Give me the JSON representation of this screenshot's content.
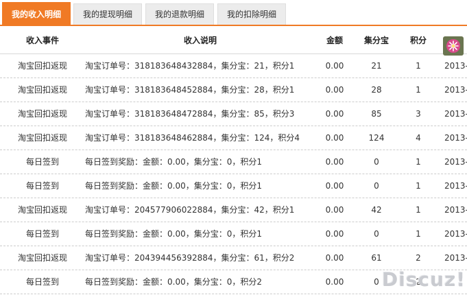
{
  "tabs": [
    {
      "label": "我的收入明细",
      "active": true
    },
    {
      "label": "我的提现明细",
      "active": false
    },
    {
      "label": "我的退款明细",
      "active": false
    },
    {
      "label": "我的扣除明细",
      "active": false
    }
  ],
  "colors": {
    "accent": "#f07a25",
    "tab_inactive": "#ececec"
  },
  "table": {
    "headers": [
      "收入事件",
      "收入说明",
      "金额",
      "集分宝",
      "积分"
    ],
    "rows": [
      {
        "event": "淘宝回扣返现",
        "desc": "淘宝订单号：318183648432884，集分宝：21，积分1",
        "amount": "0.00",
        "jfb": "21",
        "points": "1",
        "date": "2013-"
      },
      {
        "event": "淘宝回扣返现",
        "desc": "淘宝订单号：318183648452884，集分宝：28，积分1",
        "amount": "0.00",
        "jfb": "28",
        "points": "1",
        "date": "2013-"
      },
      {
        "event": "淘宝回扣返现",
        "desc": "淘宝订单号：318183648472884，集分宝：85，积分3",
        "amount": "0.00",
        "jfb": "85",
        "points": "3",
        "date": "2013-"
      },
      {
        "event": "淘宝回扣返现",
        "desc": "淘宝订单号：318183648462884，集分宝：124，积分4",
        "amount": "0.00",
        "jfb": "124",
        "points": "4",
        "date": "2013-"
      },
      {
        "event": "每日签到",
        "desc": "每日签到奖励：金额：0.00，集分宝：0，积分1",
        "amount": "0.00",
        "jfb": "0",
        "points": "1",
        "date": "2013-"
      },
      {
        "event": "每日签到",
        "desc": "每日签到奖励：金额：0.00，集分宝：0，积分1",
        "amount": "0.00",
        "jfb": "0",
        "points": "1",
        "date": "2013-"
      },
      {
        "event": "淘宝回扣返现",
        "desc": "淘宝订单号：204577906022884，集分宝：42，积分1",
        "amount": "0.00",
        "jfb": "42",
        "points": "1",
        "date": "2013-"
      },
      {
        "event": "每日签到",
        "desc": "每日签到奖励：金额：0.00，集分宝：0，积分1",
        "amount": "0.00",
        "jfb": "0",
        "points": "1",
        "date": "2013-"
      },
      {
        "event": "淘宝回扣返现",
        "desc": "淘宝订单号：204394456392884，集分宝：61，积分2",
        "amount": "0.00",
        "jfb": "61",
        "points": "2",
        "date": "2013-"
      },
      {
        "event": "每日签到",
        "desc": "每日签到奖励：金额：0.00，集分宝：0，积分2",
        "amount": "0.00",
        "jfb": "0",
        "points": "2",
        "date": ""
      }
    ]
  },
  "floater_icon": "flower-icon",
  "watermark": "Discuz!"
}
